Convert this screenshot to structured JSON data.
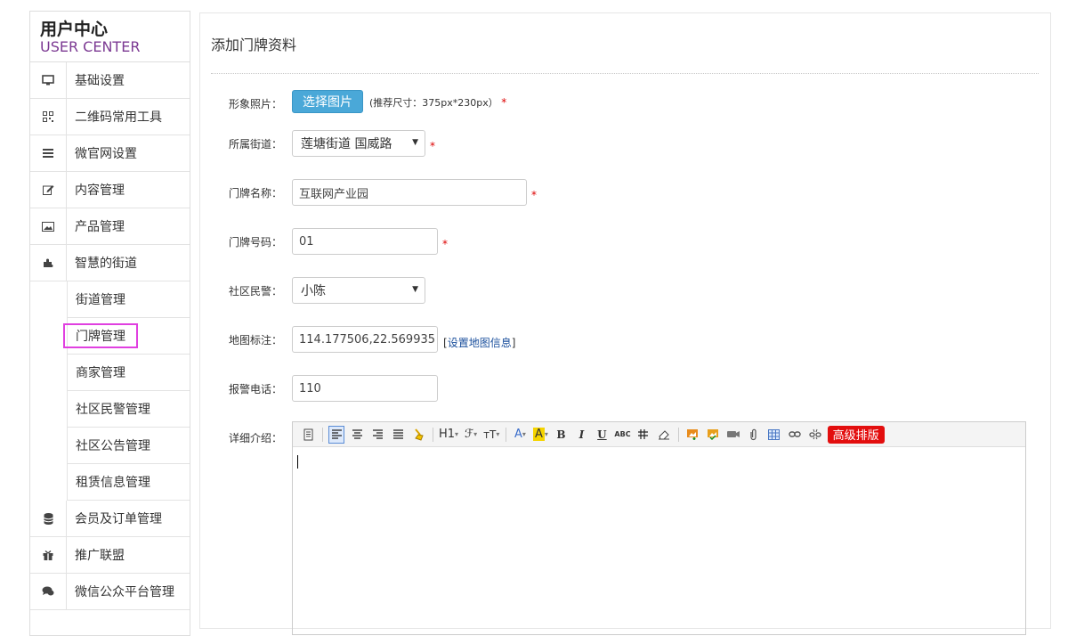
{
  "sidebar": {
    "brand_cn": "用户中心",
    "brand_en": "USER CENTER",
    "items": [
      {
        "label": "基础设置",
        "icon": "monitor-icon"
      },
      {
        "label": "二维码常用工具",
        "icon": "qrcode-icon"
      },
      {
        "label": "微官网设置",
        "icon": "list-icon"
      },
      {
        "label": "内容管理",
        "icon": "edit-icon"
      },
      {
        "label": "产品管理",
        "icon": "picture-icon"
      },
      {
        "label": "智慧的街道",
        "icon": "puzzle-icon"
      }
    ],
    "subitems": [
      {
        "label": "街道管理"
      },
      {
        "label": "门牌管理",
        "active": true
      },
      {
        "label": "商家管理"
      },
      {
        "label": "社区民警管理"
      },
      {
        "label": "社区公告管理"
      },
      {
        "label": "租赁信息管理"
      }
    ],
    "items_after": [
      {
        "label": "会员及订单管理",
        "icon": "database-icon"
      },
      {
        "label": "推广联盟",
        "icon": "gift-icon"
      },
      {
        "label": "微信公众平台管理",
        "icon": "comments-icon"
      }
    ]
  },
  "main": {
    "title": "添加门牌资料",
    "photo": {
      "label": "形象照片：",
      "button": "选择图片",
      "hint": "(推荐尺寸：375px*230px）",
      "required": "*"
    },
    "street": {
      "label": "所属街道：",
      "value": "莲塘街道 国威路",
      "required": "*"
    },
    "name": {
      "label": "门牌名称：",
      "value": "互联网产业园",
      "required": "*"
    },
    "number": {
      "label": "门牌号码：",
      "value": "01",
      "required": "*"
    },
    "police": {
      "label": "社区民警：",
      "value": "小陈"
    },
    "map": {
      "label": "地图标注：",
      "value": "114.177506,22.569935",
      "link_open": "[",
      "link": "设置地图信息",
      "link_close": "]"
    },
    "phone": {
      "label": "报警电话：",
      "value": "110"
    },
    "detail": {
      "label": "详细介绍："
    },
    "toolbar": {
      "h1": "H1",
      "font": "ℱ",
      "size": "тT",
      "fontcolor": "A",
      "bgcolor": "A",
      "bold": "B",
      "italic": "I",
      "underline": "U",
      "strike": "ABC",
      "advanced": "高级排版"
    }
  }
}
